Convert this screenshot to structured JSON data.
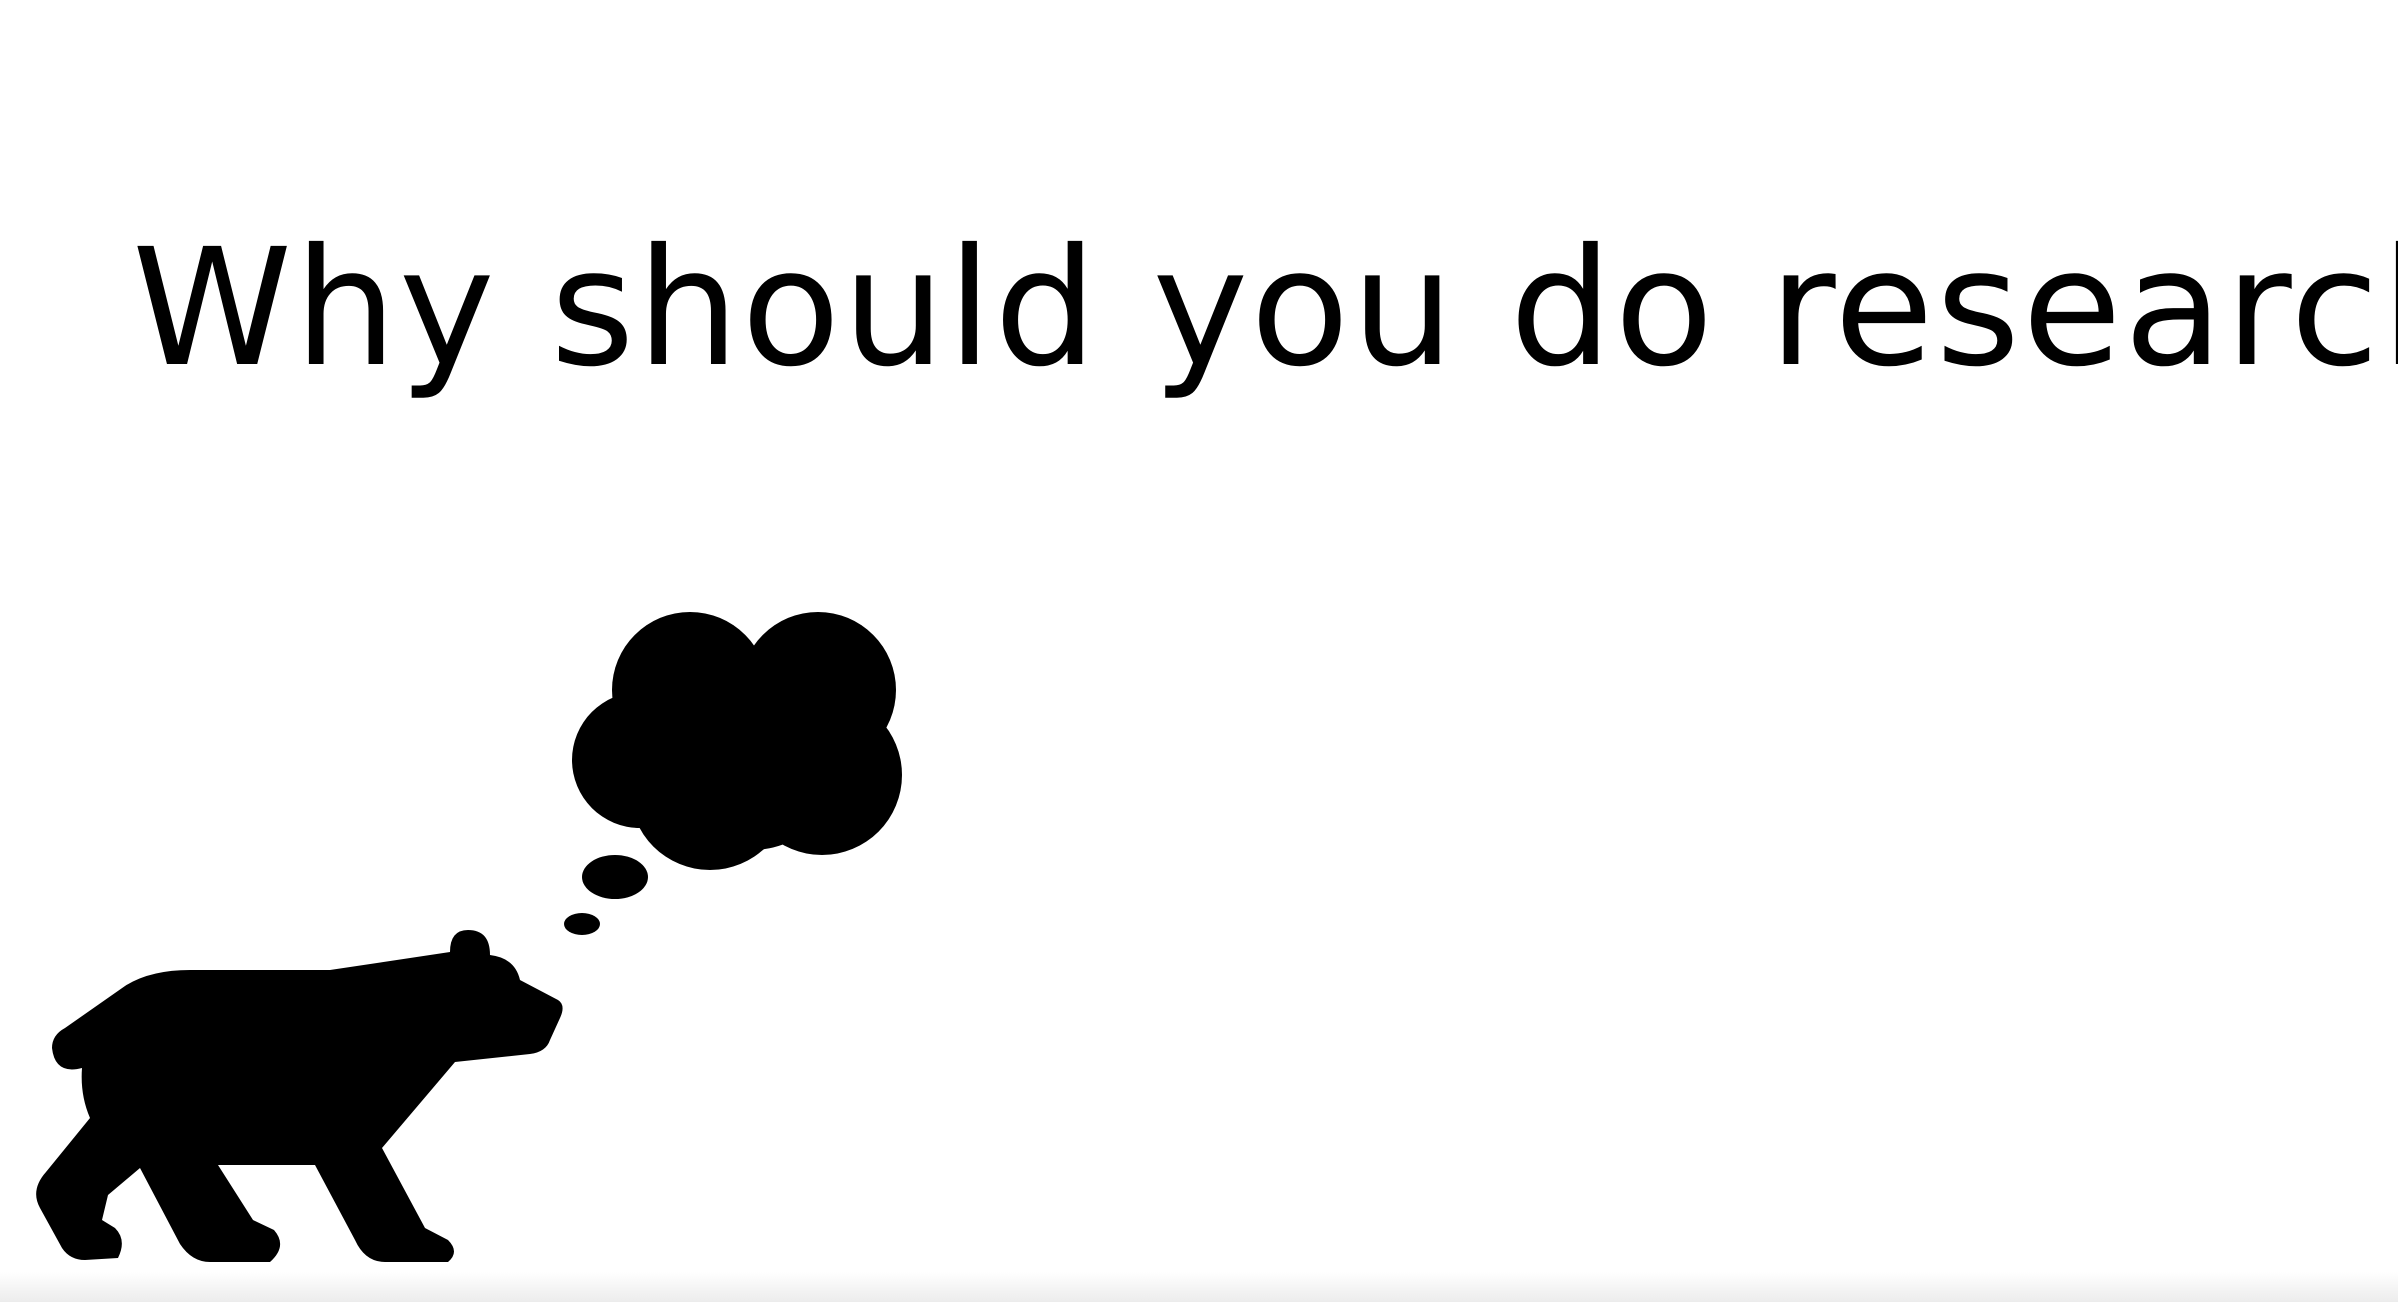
{
  "slide": {
    "title": "Why should you do research?",
    "illustration": {
      "icon": "bear-thinking-icon",
      "color": "#000000"
    },
    "background_color": "#ffffff"
  }
}
